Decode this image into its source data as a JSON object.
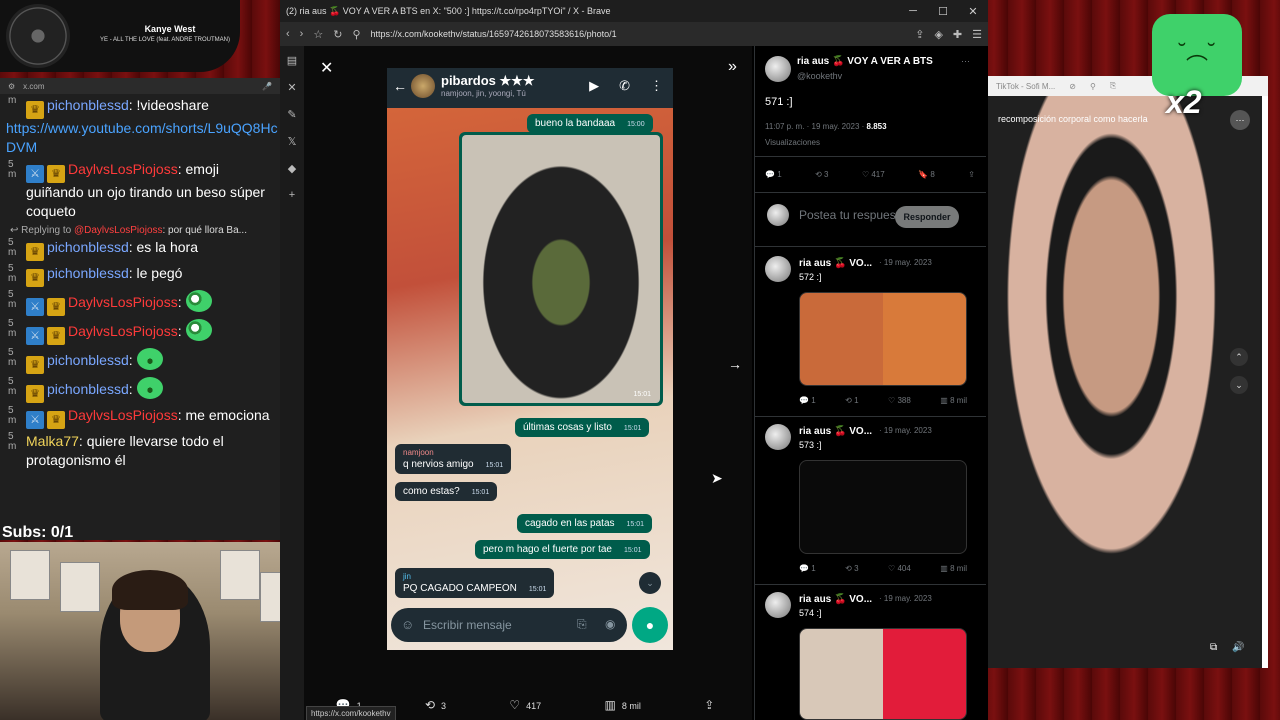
{
  "now_playing": {
    "artist": "Kanye West",
    "track": "YE - ALL THE LOVE (feat. ANDRE TROUTMAN)"
  },
  "chat": {
    "url": "x.com",
    "messages": [
      {
        "ts": "m",
        "user": "pichonblessd",
        "user_color": "blue",
        "badges": [
          "crown"
        ],
        "text": ": !videoshare",
        "link": "https://www.youtube.com/shorts/L9uQQ8HcDVM"
      },
      {
        "ts": "5 m",
        "user": "DaylvsLosPiojoss",
        "user_color": "red",
        "badges": [
          "sword",
          "crown"
        ],
        "text": ": emoji guiñando un ojo tirando un beso súper coqueto"
      },
      {
        "reply_label": "Replying to",
        "reply_to": "@DaylvsLosPiojoss",
        "reply_text": ": por qué llora Ba..."
      },
      {
        "ts": "5 m",
        "user": "pichonblessd",
        "user_color": "blue",
        "badges": [
          "crown"
        ],
        "text": ": es la hora"
      },
      {
        "ts": "5 m",
        "user": "pichonblessd",
        "user_color": "blue",
        "badges": [
          "crown"
        ],
        "text": ": le pegó"
      },
      {
        "ts": "5 m",
        "user": "DaylvsLosPiojoss",
        "user_color": "red",
        "badges": [
          "sword",
          "crown"
        ],
        "text": ":",
        "emote": "em-blue"
      },
      {
        "ts": "5 m",
        "user": "DaylvsLosPiojoss",
        "user_color": "red",
        "badges": [
          "sword",
          "crown"
        ],
        "text": ":",
        "emote": "em-blue"
      },
      {
        "ts": "5 m",
        "user": "pichonblessd",
        "user_color": "blue",
        "badges": [
          "crown"
        ],
        "text": ":",
        "emote": "em-green"
      },
      {
        "ts": "5 m",
        "user": "pichonblessd",
        "user_color": "blue",
        "badges": [
          "crown"
        ],
        "text": ":",
        "emote": "em-green"
      },
      {
        "ts": "5 m",
        "user": "DaylvsLosPiojoss",
        "user_color": "red",
        "badges": [
          "sword",
          "crown"
        ],
        "text": ": me emociona"
      },
      {
        "ts": "5 m",
        "user": "Malka77",
        "user_color": "yellow",
        "badges": [],
        "text": ": quiere llevarse todo el protagonismo él"
      }
    ],
    "subs": "Subs: 0/1"
  },
  "browser": {
    "tab_title": "(2) ria aus 🍒 VOY A VER A BTS en X: \"500 :] https://t.co/rpo4rpTYOi\" / X - Brave",
    "url": "https://x.com/kookethv/status/1659742618073583616/photo/1",
    "status_url": "https://x.com/kookethv"
  },
  "whatsapp": {
    "chat_name": "pibardos ★★★",
    "members": "namjoon, jin, yoongi, Tú",
    "messages": [
      {
        "text": "bueno la bandaaa",
        "time": "15:00",
        "dir": "out"
      },
      {
        "photo": true,
        "time": "15:01"
      },
      {
        "text": "últimas cosas y listo",
        "time": "15:01",
        "dir": "out"
      },
      {
        "sender": "namjoon",
        "text": "q nervios amigo",
        "time": "15:01",
        "dir": "in"
      },
      {
        "text": "como estas?",
        "time": "15:01",
        "dir": "in"
      },
      {
        "text": "cagado en las patas",
        "time": "15:01",
        "dir": "out"
      },
      {
        "text": "pero m hago el fuerte por tae",
        "time": "15:01",
        "dir": "out"
      },
      {
        "sender": "jin",
        "text": "PQ CAGADO CAMPEON",
        "time": "15:01",
        "dir": "in"
      }
    ],
    "input_placeholder": "Escribir mensaje"
  },
  "photo_actions": {
    "replies": "1",
    "reposts": "3",
    "likes": "417",
    "views": "8 mil"
  },
  "tweet": {
    "author": "ria aus 🍒 VOY A VER A BTS",
    "handle": "@kookethv",
    "text": "571 :]",
    "time": "11:07 p. m. · 19 may. 2023 ·",
    "views_count": "8.853",
    "views_label": "Visualizaciones",
    "stats": {
      "replies": "1",
      "reposts": "3",
      "likes": "417",
      "bookmarks": "8"
    },
    "reply_placeholder": "Postea tu respuesta",
    "reply_button": "Responder",
    "replies": [
      {
        "author": "ria aus 🍒 VO...",
        "date": "· 19 may. 2023",
        "text": "572 :]",
        "stats": {
          "replies": "1",
          "reposts": "1",
          "likes": "388",
          "views": "8 mil"
        }
      },
      {
        "author": "ria aus 🍒 VO...",
        "date": "· 19 may. 2023",
        "text": "573 :]",
        "stats": {
          "replies": "1",
          "reposts": "3",
          "likes": "404",
          "views": "8 mil"
        }
      },
      {
        "author": "ria aus 🍒 VO...",
        "date": "· 19 may. 2023",
        "text": "574 :]"
      }
    ]
  },
  "tiktok": {
    "tab": "TikTok - Sofi M...",
    "title": "recomposición corporal como hacerla"
  },
  "overlay": {
    "multiplier": "x2"
  }
}
